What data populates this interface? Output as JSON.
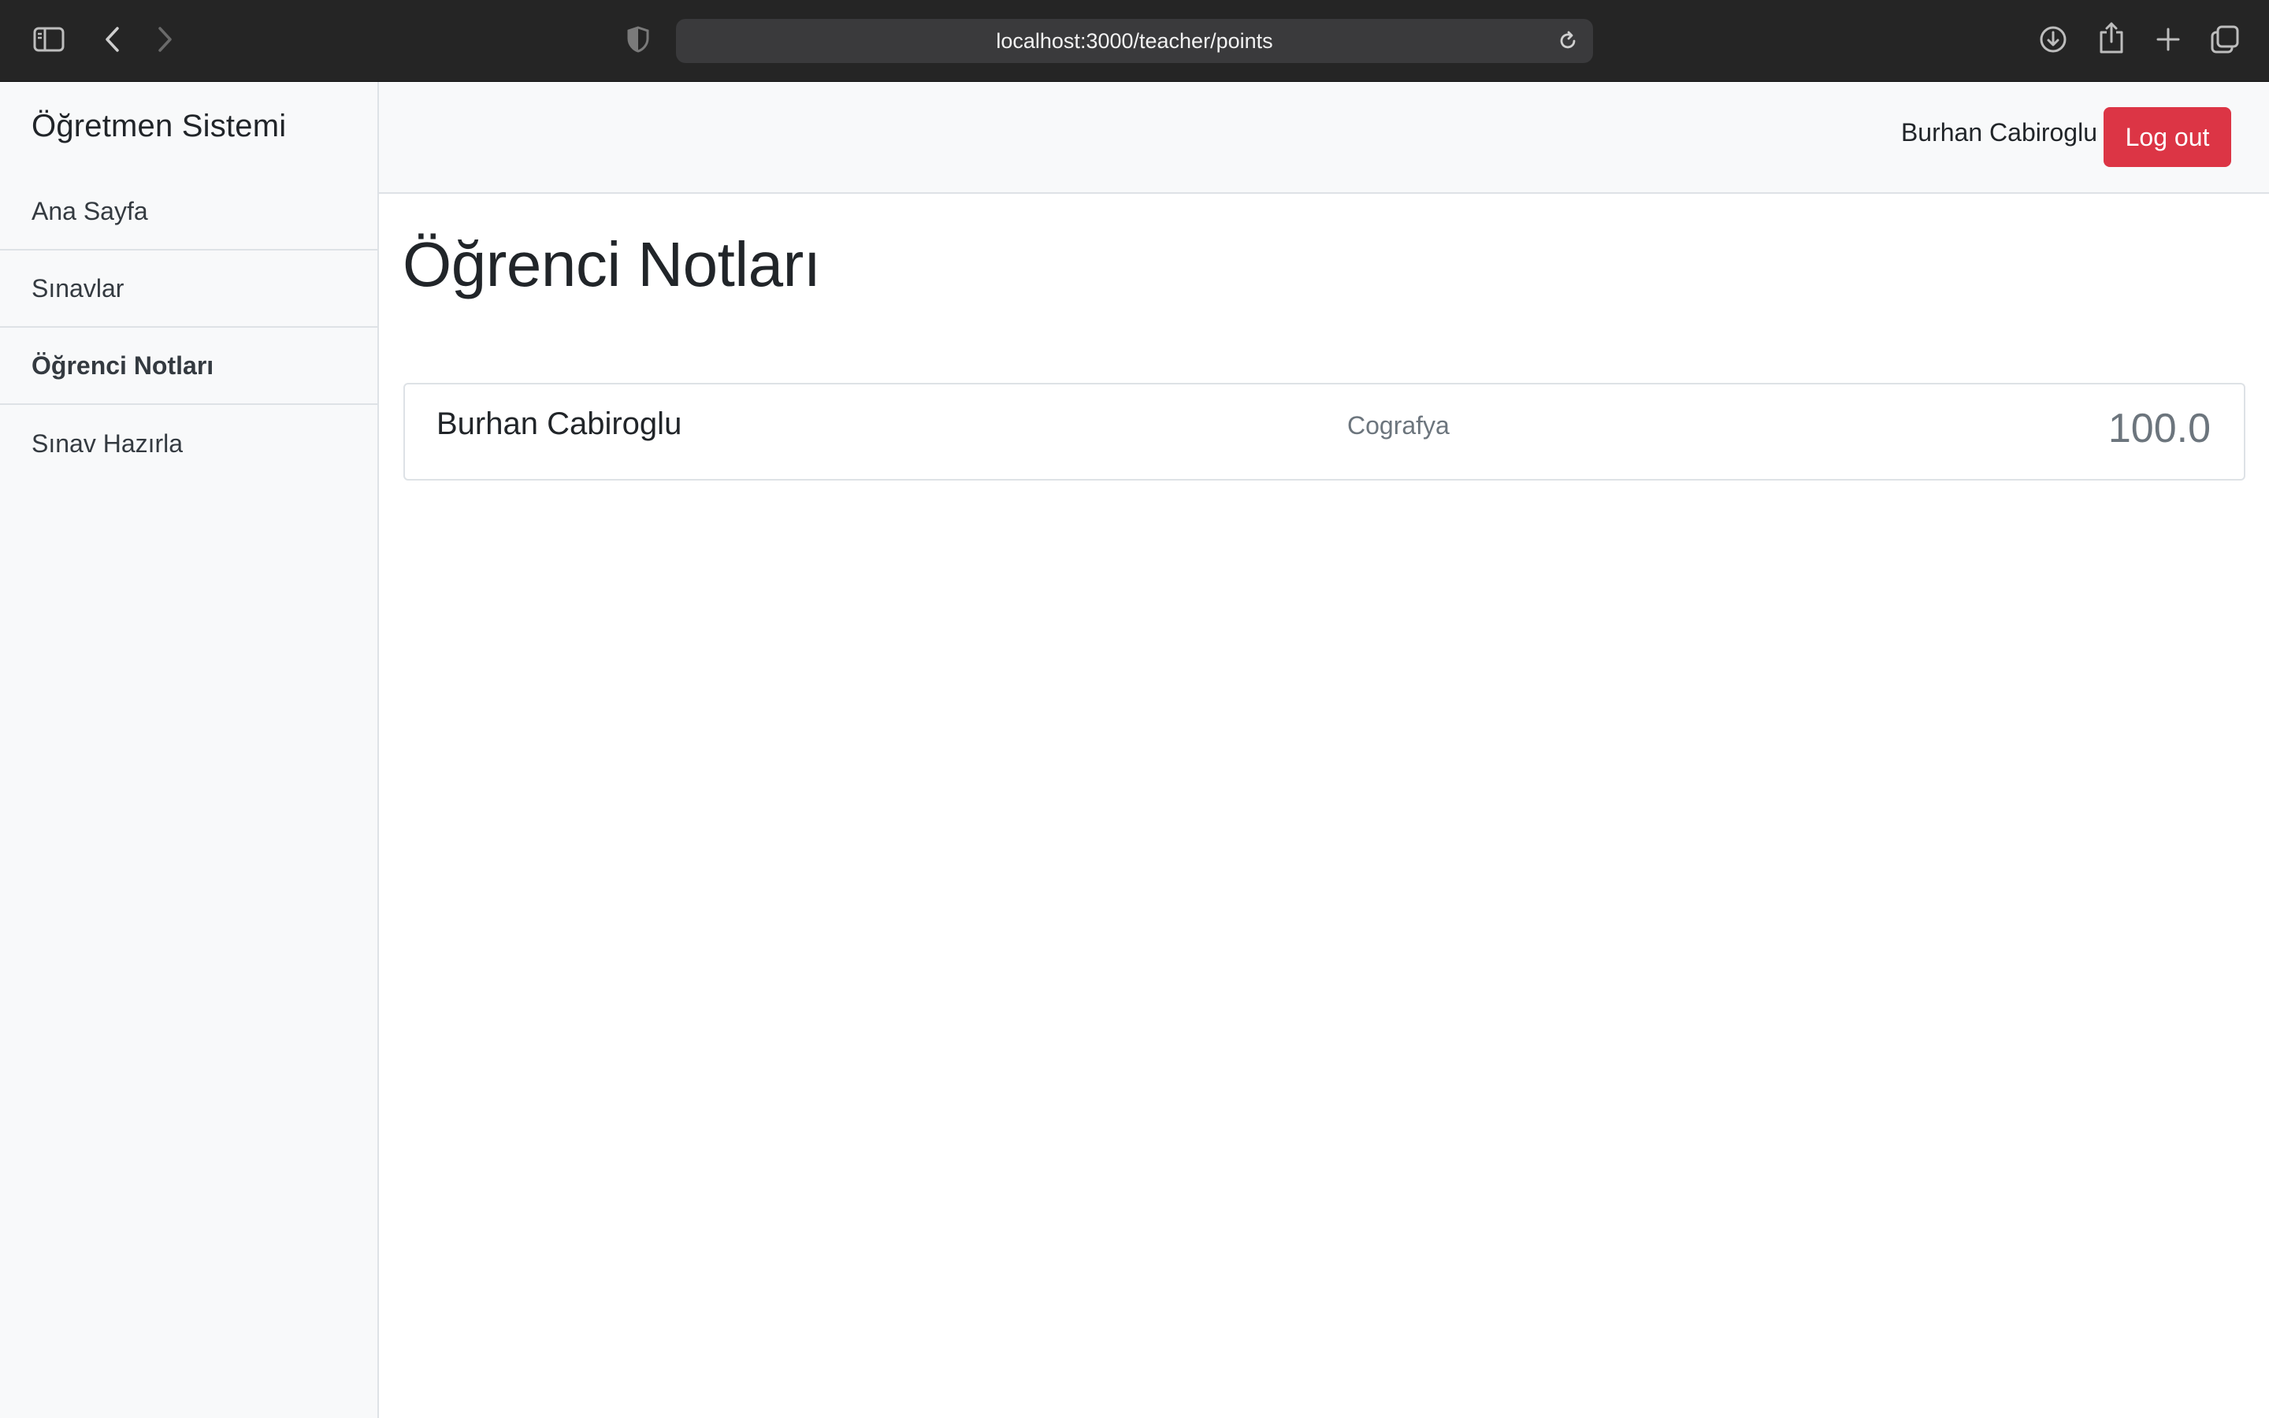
{
  "browser": {
    "url": "localhost:3000/teacher/points"
  },
  "sidebar": {
    "brand": "Öğretmen Sistemi",
    "items": [
      {
        "label": "Ana Sayfa",
        "active": false
      },
      {
        "label": "Sınavlar",
        "active": false
      },
      {
        "label": "Öğrenci Notları",
        "active": true
      },
      {
        "label": "Sınav Hazırla",
        "active": false
      }
    ]
  },
  "header": {
    "user_name": "Burhan Cabiroglu",
    "logout_label": "Log out",
    "logout_color": "#dc3545"
  },
  "main": {
    "title": "Öğrenci Notları",
    "grades": [
      {
        "student": "Burhan Cabiroglu",
        "subject": "Cografya",
        "score": "100.0"
      }
    ]
  }
}
